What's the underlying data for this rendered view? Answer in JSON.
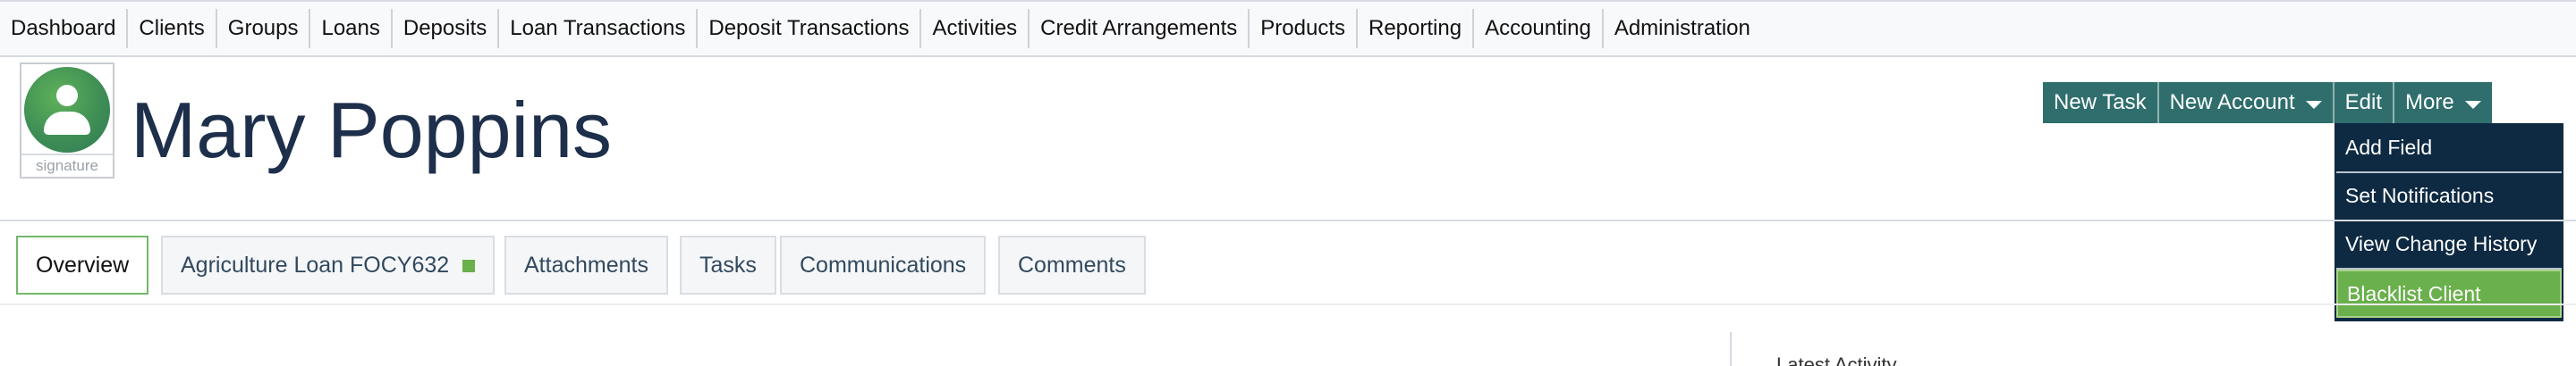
{
  "topnav": {
    "items": [
      "Dashboard",
      "Clients",
      "Groups",
      "Loans",
      "Deposits",
      "Loan Transactions",
      "Deposit Transactions",
      "Activities",
      "Credit Arrangements",
      "Products",
      "Reporting",
      "Accounting",
      "Administration"
    ]
  },
  "profile": {
    "name": "Mary Poppins",
    "signature_label": "signature"
  },
  "actions": {
    "new_task": "New Task",
    "new_account": "New Account",
    "edit": "Edit",
    "more": "More"
  },
  "more_menu": {
    "items": [
      "Add Field",
      "Set Notifications",
      "View Change History",
      "Blacklist Client"
    ],
    "highlighted": "Blacklist Client"
  },
  "tabs": [
    "Overview",
    "Agriculture Loan FOCY632",
    "Attachments",
    "Tasks",
    "Communications",
    "Comments"
  ],
  "side_panel": {
    "heading": "Latest Activity"
  },
  "colors": {
    "nav_bg": "#f8f9fb",
    "action_bar": "#2f6e6c",
    "menu_bg": "#0e2a42",
    "menu_highlight": "#6ab04c",
    "name_text": "#1d2f4a",
    "active_tab_border": "#74b86a"
  }
}
